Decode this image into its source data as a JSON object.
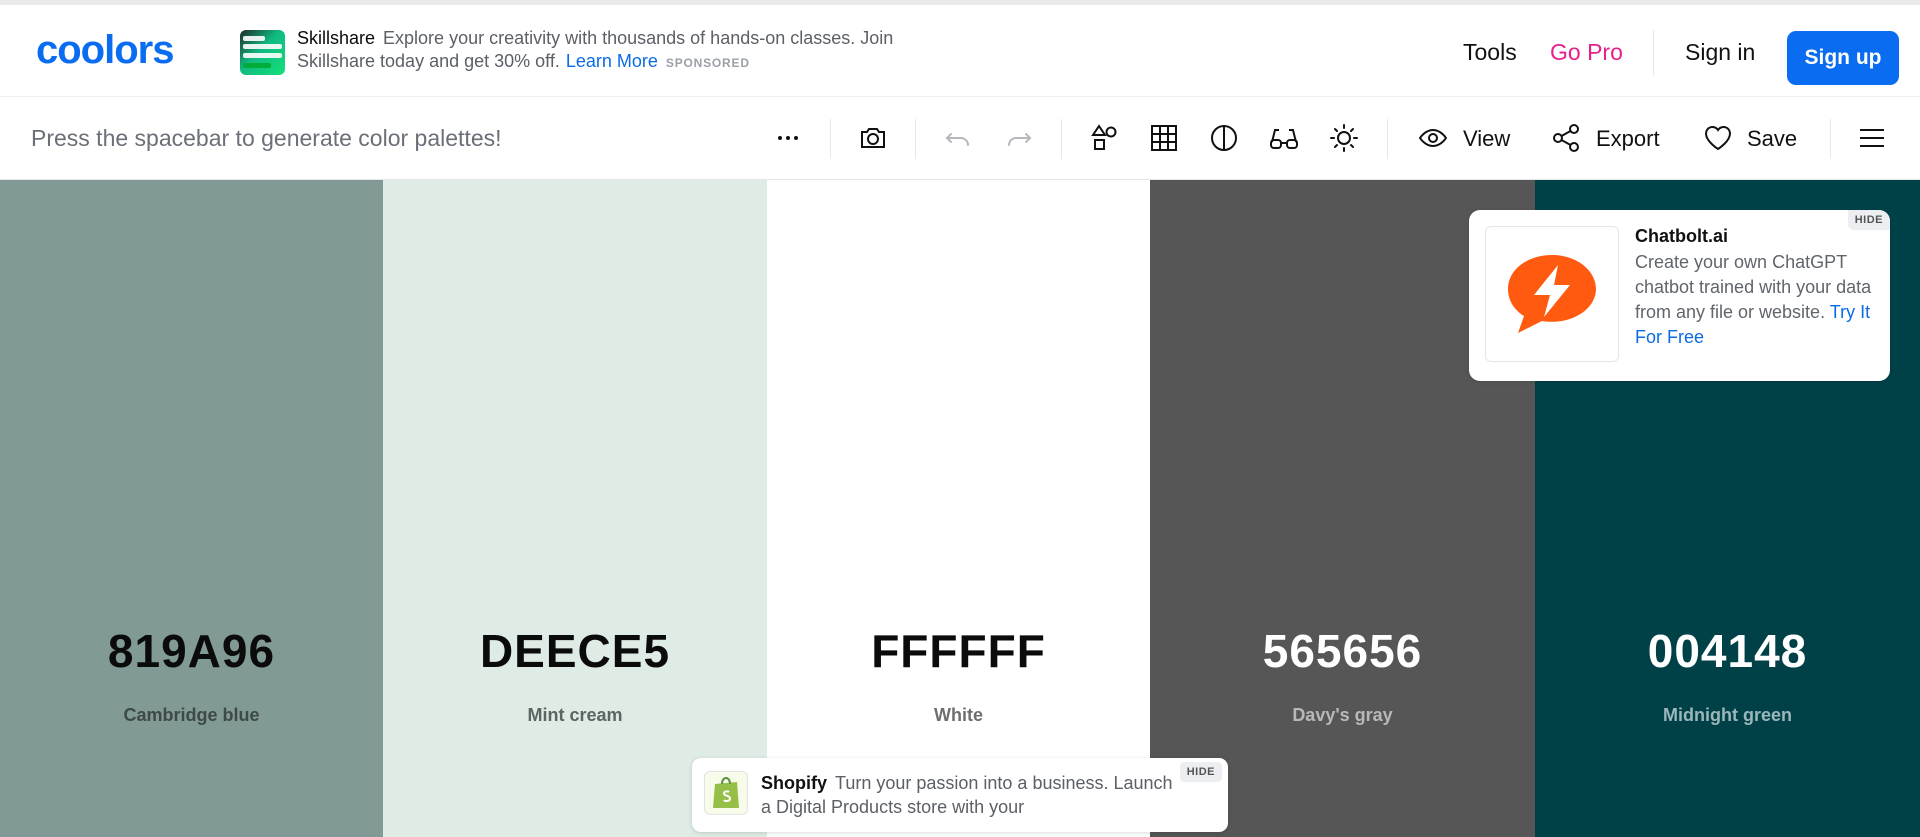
{
  "header": {
    "logo_text": "coolors",
    "ad": {
      "brand": "Skillshare",
      "text": "Explore your creativity with thousands of hands-on classes. Join Skillshare today and get 30% off.",
      "link": "Learn More",
      "sponsored": "SPONSORED"
    },
    "nav": {
      "tools": "Tools",
      "gopro": "Go Pro",
      "signin": "Sign in",
      "signup": "Sign up"
    }
  },
  "toolbar": {
    "hint": "Press the spacebar to generate color palettes!",
    "view_label": "View",
    "export_label": "Export",
    "save_label": "Save",
    "icons": [
      "more-icon",
      "camera-icon",
      "undo-icon",
      "redo-icon",
      "shapes-icon",
      "grid-icon",
      "contrast-icon",
      "glasses-icon",
      "sun-icon",
      "eye-icon",
      "share-icon",
      "heart-icon",
      "menu-icon"
    ]
  },
  "palette": [
    {
      "hex": "819A96",
      "name": "Cambridge blue",
      "bg": "#819A96",
      "fg": "#0b0b0b",
      "sub": "#3d4a48"
    },
    {
      "hex": "DEECE5",
      "name": "Mint cream",
      "bg": "#DEECE5",
      "fg": "#0b0b0b",
      "sub": "#5b6662"
    },
    {
      "hex": "FFFFFF",
      "name": "White",
      "bg": "#FFFFFF",
      "fg": "#0b0b0b",
      "sub": "#6e6e6e"
    },
    {
      "hex": "565656",
      "name": "Davy's gray",
      "bg": "#565656",
      "fg": "#ffffff",
      "sub": "#b8b8b8"
    },
    {
      "hex": "004148",
      "name": "Midnight green",
      "bg": "#004148",
      "fg": "#ffffff",
      "sub": "#9ab7ba"
    }
  ],
  "ad_card": {
    "title": "Chatbolt.ai",
    "body": "Create your own ChatGPT chatbot trained with your data from any file or website.",
    "link": "Try It For Free",
    "hide": "HIDE"
  },
  "shop_card": {
    "brand": "Shopify",
    "text": "Turn your passion into a business. Launch a Digital Products store with your",
    "hide": "HIDE"
  },
  "colors": {
    "accent": "#0A6CF0",
    "gopro": "#E6208B",
    "chatbolt": "#FF5A0F",
    "shopify": "#95BF47"
  }
}
